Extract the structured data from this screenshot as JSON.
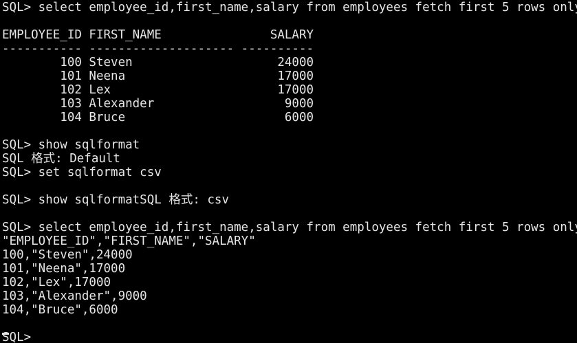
{
  "terminal": {
    "colors": {
      "background": "#000000",
      "foreground": "#e6e6e6"
    },
    "lines": [
      "SQL> select employee_id,first_name,salary from employees fetch first 5 rows only;",
      "",
      "EMPLOYEE_ID FIRST_NAME               SALARY",
      "----------- -------------------- ----------",
      "        100 Steven                    24000",
      "        101 Neena                     17000",
      "        102 Lex                       17000",
      "        103 Alexander                  9000",
      "        104 Bruce                      6000",
      "",
      "SQL> show sqlformat",
      "SQL 格式: Default",
      "SQL> set sqlformat csv",
      "",
      "SQL> show sqlformatSQL 格式: csv",
      "",
      "SQL> select employee_id,first_name,salary from employees fetch first 5 rows only;",
      "\"EMPLOYEE_ID\",\"FIRST_NAME\",\"SALARY\"",
      "100,\"Steven\",24000",
      "101,\"Neena\",17000",
      "102,\"Lex\",17000",
      "103,\"Alexander\",9000",
      "104,\"Bruce\",6000",
      "",
      "SQL>"
    ]
  }
}
